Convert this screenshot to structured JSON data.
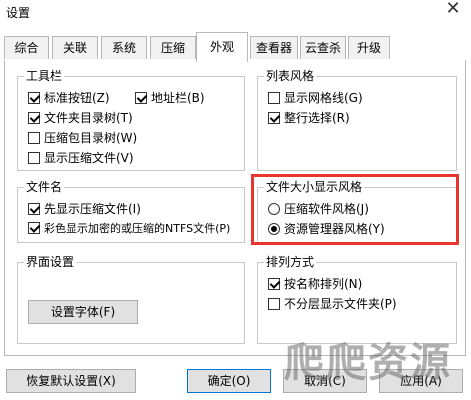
{
  "window": {
    "title": "设置",
    "close_glyph": "✕"
  },
  "tabs": [
    {
      "label": "综合"
    },
    {
      "label": "关联"
    },
    {
      "label": "系统"
    },
    {
      "label": "压缩"
    },
    {
      "label": "外观"
    },
    {
      "label": "查看器"
    },
    {
      "label": "云查杀"
    },
    {
      "label": "升级"
    }
  ],
  "active_tab": "外观",
  "toolbar_group": {
    "title": "工具栏",
    "items": [
      {
        "label": "标准按钮(Z)",
        "checked": true
      },
      {
        "label": "地址栏(B)",
        "checked": true
      },
      {
        "label": "文件夹目录树(T)",
        "checked": true
      },
      {
        "label": "压缩包目录树(W)",
        "checked": false
      },
      {
        "label": "显示压缩文件(V)",
        "checked": false
      }
    ]
  },
  "list_style_group": {
    "title": "列表风格",
    "items": [
      {
        "label": "显示网格线(G)",
        "checked": false
      },
      {
        "label": "整行选择(R)",
        "checked": true
      }
    ]
  },
  "filename_group": {
    "title": "文件名",
    "items": [
      {
        "label": "先显示压缩文件(I)",
        "checked": true
      },
      {
        "label": "彩色显示加密的或压缩的NTFS文件(P)",
        "checked": true
      }
    ]
  },
  "filesize_group": {
    "title": "文件大小显示风格",
    "options": [
      {
        "label": "压缩软件风格(J)",
        "selected": false
      },
      {
        "label": "资源管理器风格(Y)",
        "selected": true
      }
    ]
  },
  "ui_group": {
    "title": "界面设置",
    "font_button": "设置字体(F)"
  },
  "sort_group": {
    "title": "排列方式",
    "items": [
      {
        "label": "按名称排列(N)",
        "checked": true
      },
      {
        "label": "不分层显示文件夹(P)",
        "checked": false
      }
    ]
  },
  "footer": {
    "restore_defaults": "恢复默认设置(X)",
    "ok": "确定(O)",
    "cancel": "取消(C)",
    "apply": "应用(A)"
  },
  "watermark": "爬爬资源",
  "colors": {
    "highlight": "#e8352e",
    "default_button_border": "#0078d7"
  }
}
